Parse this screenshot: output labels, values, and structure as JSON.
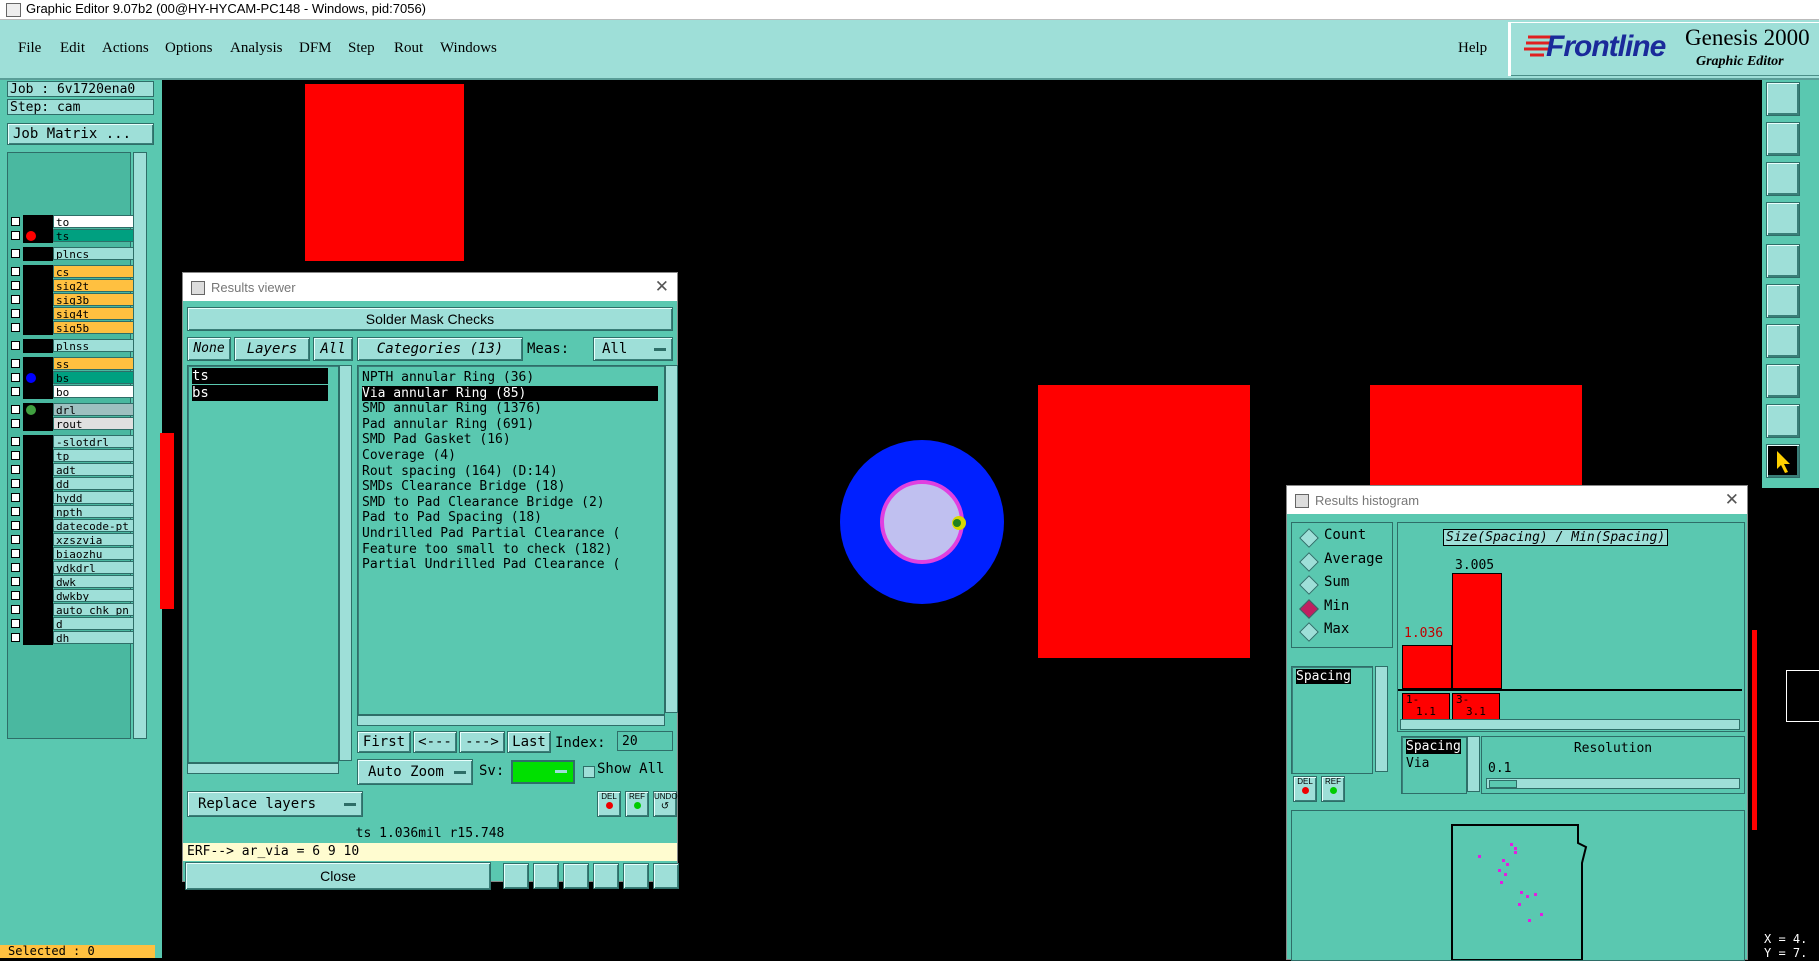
{
  "window": {
    "title": "Graphic Editor 9.07b2 (00@HY-HYCAM-PC148 - Windows, pid:7056)"
  },
  "menu": {
    "items": [
      "File",
      "Edit",
      "Actions",
      "Options",
      "Analysis",
      "DFM",
      "Step",
      "Rout",
      "Windows"
    ],
    "help": "Help"
  },
  "brand": {
    "name": "Frontline",
    "product": "Genesis 2000",
    "subtitle": "Graphic Editor"
  },
  "job": {
    "job_line": "Job : 6v1720ena0",
    "step_line": "Step: cam",
    "matrix_button": "Job Matrix ..."
  },
  "layers": [
    {
      "name": "to",
      "color": "#ffffff"
    },
    {
      "name": "ts",
      "color": "#00a080",
      "marker": "#ff0000",
      "active": true
    },
    {
      "name": "plncs",
      "color": "#9edfd8"
    },
    {
      "name": "cs",
      "color": "#ffc040"
    },
    {
      "name": "sig2t",
      "color": "#ffc040"
    },
    {
      "name": "sig3b",
      "color": "#ffc040"
    },
    {
      "name": "sig4t",
      "color": "#ffc040"
    },
    {
      "name": "sig5b",
      "color": "#ffc040"
    },
    {
      "name": "plnss",
      "color": "#9edfd8"
    },
    {
      "name": "ss",
      "color": "#ffc040"
    },
    {
      "name": "bs",
      "color": "#00a080",
      "marker": "#0000ff"
    },
    {
      "name": "bo",
      "color": "#ffffff"
    },
    {
      "name": "drl",
      "color": "#9ec0c0",
      "marker": "#40a040"
    },
    {
      "name": "rout",
      "color": "#e0e0e0"
    },
    {
      "name": "-slotdrl",
      "color": "#9edfd8"
    },
    {
      "name": "tp",
      "color": "#9edfd8"
    },
    {
      "name": "adt",
      "color": "#9edfd8"
    },
    {
      "name": "dd",
      "color": "#9edfd8"
    },
    {
      "name": "hydd",
      "color": "#9edfd8"
    },
    {
      "name": "npth",
      "color": "#9edfd8"
    },
    {
      "name": "datecode-pt",
      "color": "#9edfd8"
    },
    {
      "name": "xzszvia",
      "color": "#9edfd8"
    },
    {
      "name": "biaozhu",
      "color": "#9edfd8"
    },
    {
      "name": "ydkdrl",
      "color": "#9edfd8"
    },
    {
      "name": "dwk",
      "color": "#9edfd8"
    },
    {
      "name": "dwkby",
      "color": "#9edfd8"
    },
    {
      "name": "auto_chk_pn",
      "color": "#9edfd8"
    },
    {
      "name": "d",
      "color": "#9edfd8"
    },
    {
      "name": "dh",
      "color": "#9edfd8"
    }
  ],
  "selected": "Selected : 0",
  "results_viewer": {
    "title": "Results viewer",
    "header": "Solder Mask Checks",
    "none_btn": "None",
    "layers_btn": "Layers",
    "all_btn": "All",
    "layer_list": [
      "ts",
      "bs"
    ],
    "categories_btn": "Categories (13)",
    "meas_label": "Meas:",
    "meas_value": "All",
    "categories": [
      "NPTH annular Ring (36)",
      "Via annular Ring (85)",
      "SMD annular Ring (1376)",
      "Pad annular Ring (691)",
      "SMD Pad Gasket (16)",
      "Coverage (4)",
      "Rout spacing (164)        (D:14)",
      "SMDs Clearance Bridge (18)",
      "SMD to Pad Clearance Bridge (2)",
      "Pad to Pad Spacing (18)",
      "Undrilled Pad Partial Clearance (",
      "Feature too small to check (182)",
      "Partial Undrilled Pad Clearance ("
    ],
    "selected_category_index": 1,
    "first_btn": "First",
    "prev_btn": "<---",
    "next_btn": "--->",
    "last_btn": "Last",
    "index_label": "Index:",
    "index_value": "20",
    "auto_zoom": "Auto Zoom",
    "sv_label": "Sv:",
    "show_all": "Show All",
    "replace_layers": "Replace layers",
    "del_label": "DEL",
    "ref_label": "REF",
    "undo_label": "UNDO",
    "status": "ts 1.036mil  r15.748",
    "erf_line": "ERF--> ar_via = 6 9 10",
    "close_btn": "Close"
  },
  "histogram": {
    "title": "Results histogram",
    "modes": [
      "Count",
      "Average",
      "Sum",
      "Min",
      "Max"
    ],
    "selected_mode": "Min",
    "measure_list": [
      "Spacing"
    ],
    "chart_title": "Size(Spacing) / Min(Spacing)",
    "bins": [
      {
        "range_top": "1-",
        "range_bottom": "1.1",
        "value": "1.036"
      },
      {
        "range_top": "3-",
        "range_bottom": "3.1",
        "value": "3.005"
      }
    ],
    "spacing_list": [
      "Spacing",
      "Via"
    ],
    "resolution_label": "Resolution",
    "resolution_value": "0.1",
    "del_label": "DEL",
    "ref_label": "REF"
  },
  "coords": {
    "x_line": "X = 4.",
    "y_line": "Y = 7."
  },
  "colors": {
    "panel": "#5ac8b0",
    "panel_light": "#9edfd8",
    "pad_red": "#ff0000",
    "via_blue": "#0020ff",
    "via_hole": "#c0c0f0",
    "via_ring": "#e040e0"
  }
}
